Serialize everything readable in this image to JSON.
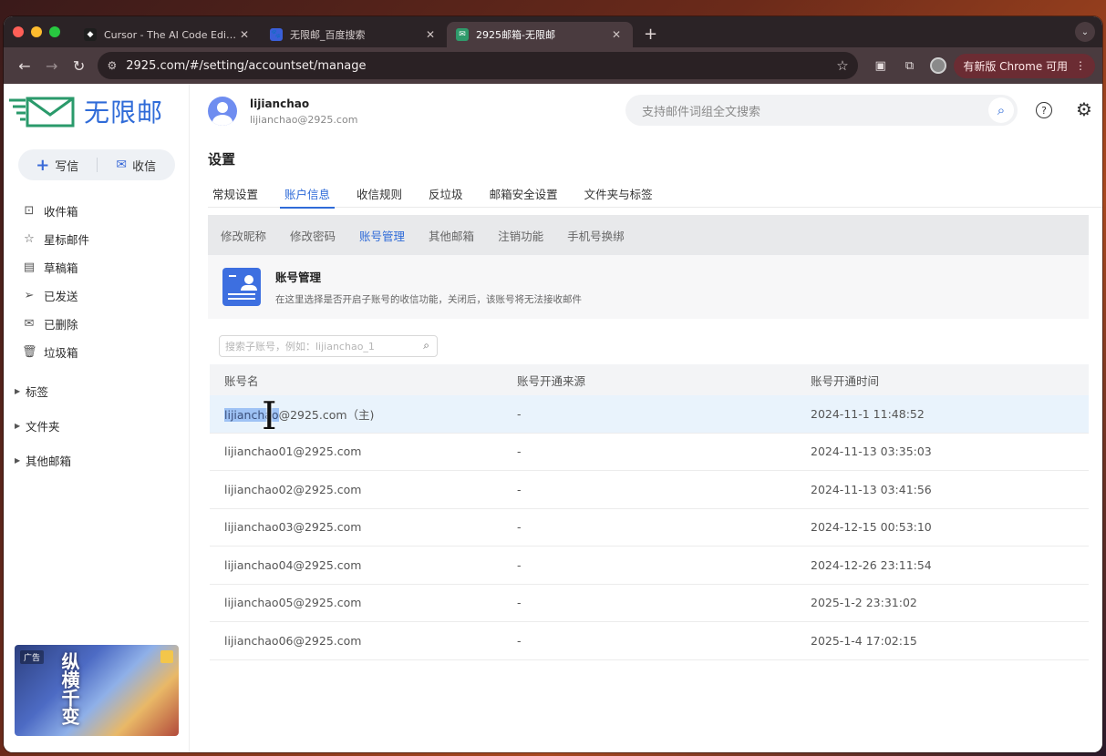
{
  "browser": {
    "tabs": [
      {
        "title": "Cursor - The AI Code Editor",
        "active": false,
        "favicon_color": "#1e1e1e"
      },
      {
        "title": "无限邮_百度搜索",
        "active": false,
        "favicon_color": "#3a5fd8"
      },
      {
        "title": "2925邮箱-无限邮",
        "active": true,
        "favicon_color": "#2f9a6b"
      }
    ],
    "url": "2925.com/#/setting/accountset/manage",
    "upgrade_label": "有新版 Chrome 可用"
  },
  "app": {
    "brand": "无限邮",
    "compose_label": "写信",
    "receive_label": "收信",
    "menu": [
      {
        "label": "收件箱",
        "icon": "inbox-icon",
        "glyph": "⊡"
      },
      {
        "label": "星标邮件",
        "icon": "star-icon",
        "glyph": "☆"
      },
      {
        "label": "草稿箱",
        "icon": "draft-icon",
        "glyph": "▤"
      },
      {
        "label": "已发送",
        "icon": "send-icon",
        "glyph": "➢"
      },
      {
        "label": "已删除",
        "icon": "deleted-icon",
        "glyph": "✉"
      },
      {
        "label": "垃圾箱",
        "icon": "trash-icon",
        "glyph": "🗑"
      }
    ],
    "groups": [
      "标签",
      "文件夹",
      "其他邮箱"
    ],
    "ad_tag": "广告"
  },
  "header": {
    "user_name": "lijianchao",
    "user_email": "lijianchao@2925.com",
    "search_placeholder": "支持邮件词组全文搜索"
  },
  "settings": {
    "title": "设置",
    "tabs": [
      "常规设置",
      "账户信息",
      "收信规则",
      "反垃圾",
      "邮箱安全设置",
      "文件夹与标签"
    ],
    "active_tab": 1,
    "subtabs": [
      "修改昵称",
      "修改密码",
      "账号管理",
      "其他邮箱",
      "注销功能",
      "手机号换绑"
    ],
    "active_subtab": 2,
    "info_title": "账号管理",
    "info_desc": "在这里选择是否开启子账号的收信功能，关闭后，该账号将无法接收邮件",
    "sub_search_placeholder": "搜索子账号，例如：lijianchao_1"
  },
  "table": {
    "headers": [
      "账号名",
      "账号开通来源",
      "账号开通时间"
    ],
    "rows": [
      {
        "selected_part": "lijianchao",
        "rest": "@2925.com（主)",
        "source": "-",
        "time": "2024-11-1 11:48:52"
      },
      {
        "name": "lijianchao01@2925.com",
        "source": "-",
        "time": "2024-11-13 03:35:03"
      },
      {
        "name": "lijianchao02@2925.com",
        "source": "-",
        "time": "2024-11-13 03:41:56"
      },
      {
        "name": "lijianchao03@2925.com",
        "source": "-",
        "time": "2024-12-15 00:53:10"
      },
      {
        "name": "lijianchao04@2925.com",
        "source": "-",
        "time": "2024-12-26 23:11:54"
      },
      {
        "name": "lijianchao05@2925.com",
        "source": "-",
        "time": "2025-1-2 23:31:02"
      },
      {
        "name": "lijianchao06@2925.com",
        "source": "-",
        "time": "2025-1-4 17:02:15"
      }
    ]
  },
  "colors": {
    "accent": "#2f6bd8",
    "selected_row": "#e9f3fc"
  }
}
